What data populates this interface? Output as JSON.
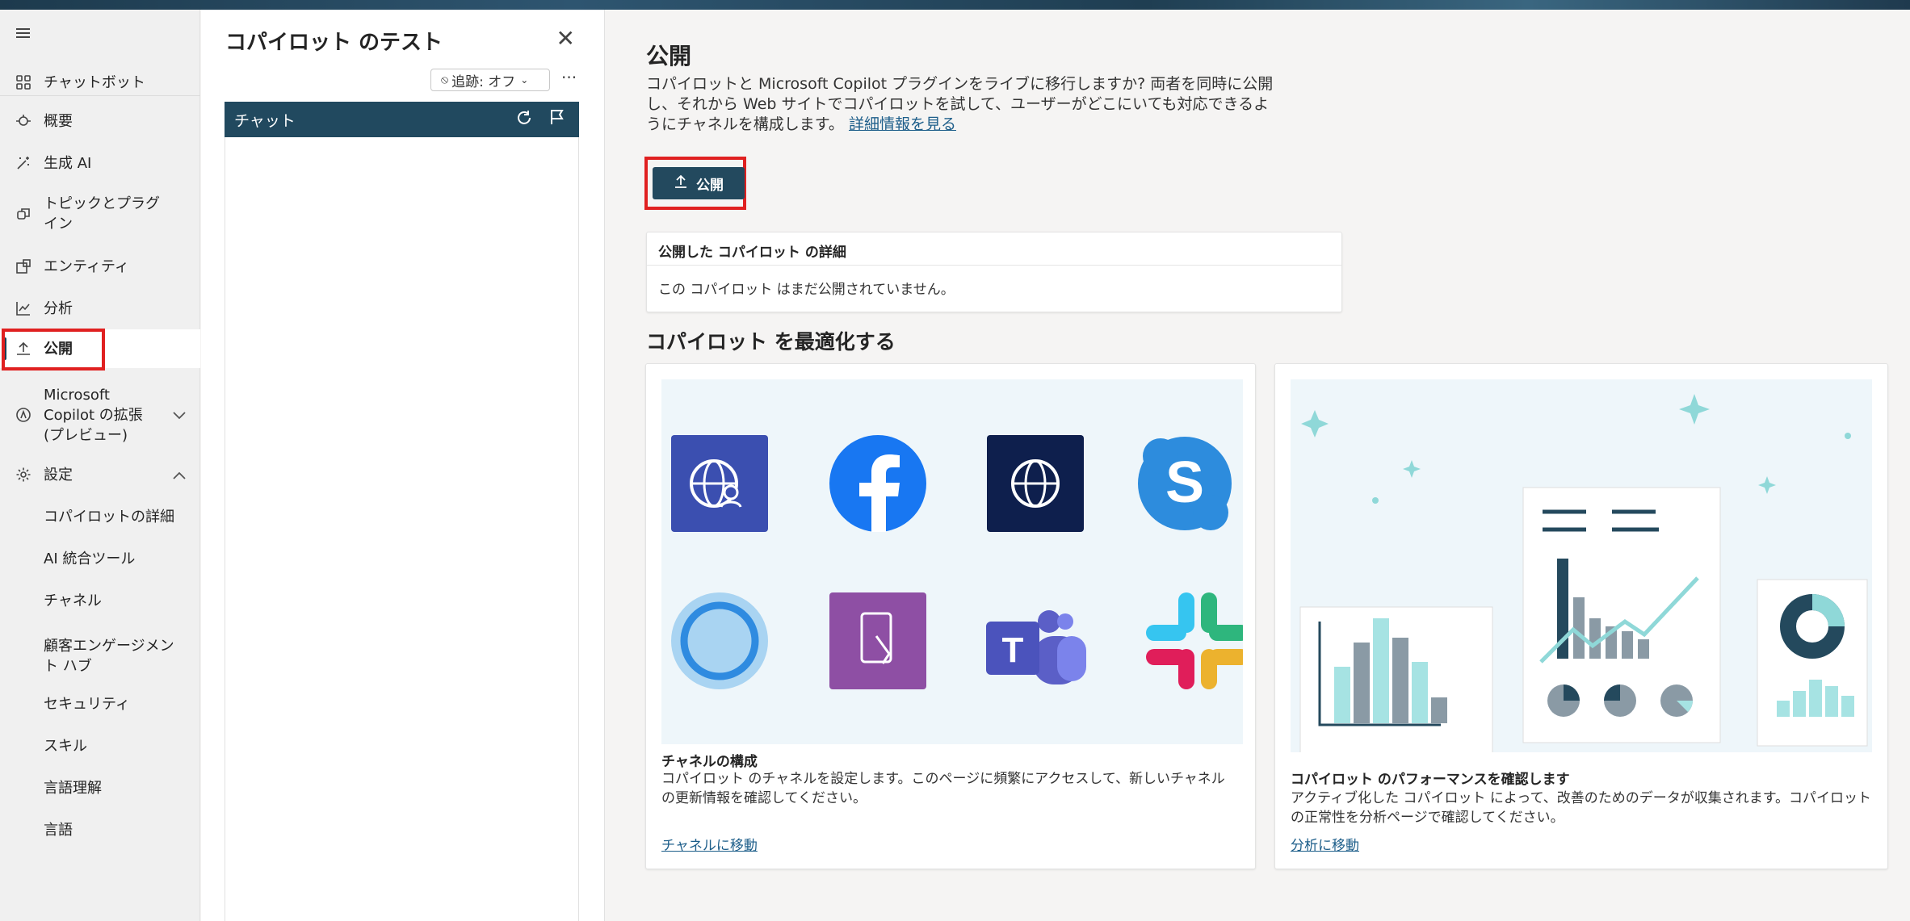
{
  "nav": {
    "items": [
      {
        "label": "チャットボット",
        "icon": "grid-icon"
      },
      {
        "label": "概要",
        "icon": "overview-icon"
      },
      {
        "label": "生成 AI",
        "icon": "magic-wand-icon"
      },
      {
        "label": "トピックとプラグイン",
        "icon": "topics-icon"
      },
      {
        "label": "エンティティ",
        "icon": "entity-icon"
      },
      {
        "label": "分析",
        "icon": "chart-icon"
      },
      {
        "label": "公開",
        "icon": "upload-icon"
      },
      {
        "label": "Microsoft Copilot の拡張 (プレビュー)",
        "icon": "copilot-icon"
      },
      {
        "label": "設定",
        "icon": "gear-icon"
      }
    ],
    "settings_sub": [
      "コパイロットの詳細",
      "AI 統合ツール",
      "チャネル",
      "顧客エンゲージメント ハブ",
      "セキュリティ",
      "スキル",
      "言語理解",
      "言語"
    ]
  },
  "test_panel": {
    "title": "コパイロット のテスト",
    "tracking": "追跡: オフ",
    "chat_label": "チャット"
  },
  "main": {
    "title": "公開",
    "description": "コパイロットと Microsoft Copilot プラグインをライブに移行しますか? 両者を同時に公開し、それから Web サイトでコパイロットを試して、ユーザーがどこにいても対応できるようにチャネルを構成します。",
    "learn_more": "詳細情報を見る",
    "publish_button": "公開",
    "details_title": "公開した コパイロット の詳細",
    "details_text": "この コパイロット はまだ公開されていません。",
    "optimize_title": "コパイロット を最適化する",
    "cards": [
      {
        "title": "チャネルの構成",
        "desc": "コパイロット のチャネルを設定します。このページに頻繁にアクセスして、新しいチャネルの更新情報を確認してください。",
        "link": "チャネルに移動"
      },
      {
        "title": "コパイロット のパフォーマンスを確認します",
        "desc": "アクティブ化した コパイロット によって、改善のためのデータが収集されます。コパイロット の正常性を分析ページで確認してください。",
        "link": "分析に移動"
      }
    ]
  },
  "colors": {
    "accent": "#23495e",
    "highlight": "#e02020",
    "link": "#1d5e8a"
  }
}
